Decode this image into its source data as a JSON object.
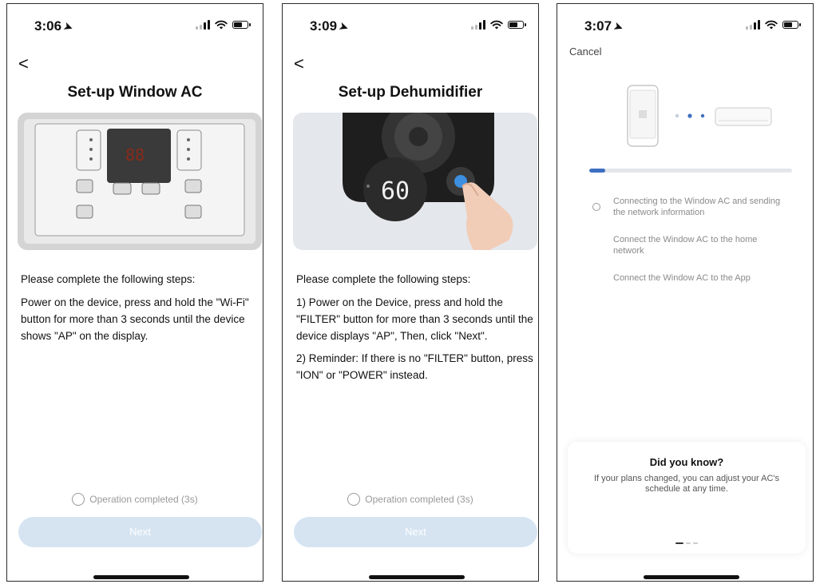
{
  "screens": [
    {
      "status": {
        "time": "3:06",
        "location_glyph": "➤"
      },
      "back_label": "<",
      "title": "Set-up Window AC",
      "steps_heading": "Please complete the following steps:",
      "steps": [
        "Power on the device, press and hold the \"Wi-Fi\" button for more than 3 seconds until the device shows \"AP\" on the display."
      ],
      "operation_completed": "Operation completed (3s)",
      "next_label": "Next"
    },
    {
      "status": {
        "time": "3:09",
        "location_glyph": "➤"
      },
      "back_label": "<",
      "title": "Set-up Dehumidifier",
      "device_display": "60",
      "steps_heading": "Please complete the following steps:",
      "steps": [
        "1) Power on the Device, press and hold the \"FILTER\" button for more than 3 seconds until the device displays \"AP\", Then,  click \"Next\".",
        "2) Reminder: If there is no \"FILTER\" button, press \"ION\" or  \"POWER\" instead."
      ],
      "operation_completed": "Operation completed (3s)",
      "next_label": "Next"
    },
    {
      "status": {
        "time": "3:07",
        "location_glyph": "➤"
      },
      "cancel_label": "Cancel",
      "progress_fraction": 0.08,
      "connection_steps": [
        "Connecting to the Window AC and sending the network information",
        "Connect the Window AC to the home network",
        "Connect the Window AC to the App"
      ],
      "tip": {
        "title": "Did you know?",
        "body": "If your plans changed, you can adjust your AC's schedule at any time."
      }
    }
  ],
  "colors": {
    "accent": "#3d6fc0",
    "next_disabled_bg": "#d6e4f2",
    "muted_text": "#8a8a8a"
  },
  "icons": {
    "back": "chevron-left-icon",
    "location": "location-arrow-icon",
    "signal": "cell-signal-icon",
    "wifi": "wifi-icon",
    "battery": "battery-icon"
  }
}
